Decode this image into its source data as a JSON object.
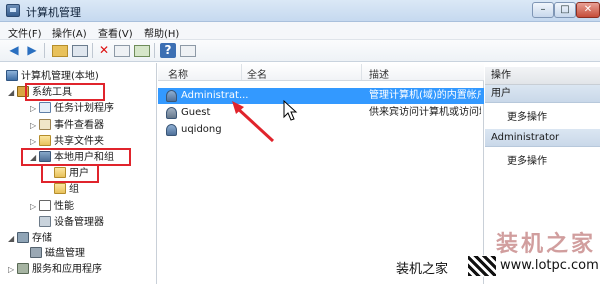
{
  "window": {
    "title": "计算机管理",
    "minimize": "–",
    "maximize": "□",
    "close": "✕"
  },
  "menu": [
    "文件(F)",
    "操作(A)",
    "查看(V)",
    "帮助(H)"
  ],
  "toolbar": {
    "back": "◀",
    "forward": "▶",
    "help": "?"
  },
  "tree": {
    "root": "计算机管理(本地)",
    "system_tools": "系统工具",
    "task_scheduler": "任务计划程序",
    "event_viewer": "事件查看器",
    "shared_folders": "共享文件夹",
    "local_users_groups": "本地用户和组",
    "users": "用户",
    "groups": "组",
    "performance": "性能",
    "device_manager": "设备管理器",
    "storage": "存储",
    "disk_management": "磁盘管理",
    "services_apps": "服务和应用程序"
  },
  "list": {
    "columns": [
      "名称",
      "全名",
      "描述"
    ],
    "rows": [
      {
        "name": "Administrat...",
        "fullname": "",
        "desc": "管理计算机(域)的内置帐户"
      },
      {
        "name": "Guest",
        "fullname": "",
        "desc": "供来宾访问计算机或访问域"
      },
      {
        "name": "uqidong",
        "fullname": "",
        "desc": ""
      }
    ]
  },
  "actions": {
    "header": "操作",
    "section1": "用户",
    "more1": "更多操作",
    "section2": "Administrator",
    "more2": "更多操作"
  },
  "watermark": {
    "big": "装机之家",
    "small": "装机之家",
    "url": "www.lotpc.com"
  },
  "colors": {
    "selection": "#3399ff",
    "highlight_box": "#e0242c"
  }
}
